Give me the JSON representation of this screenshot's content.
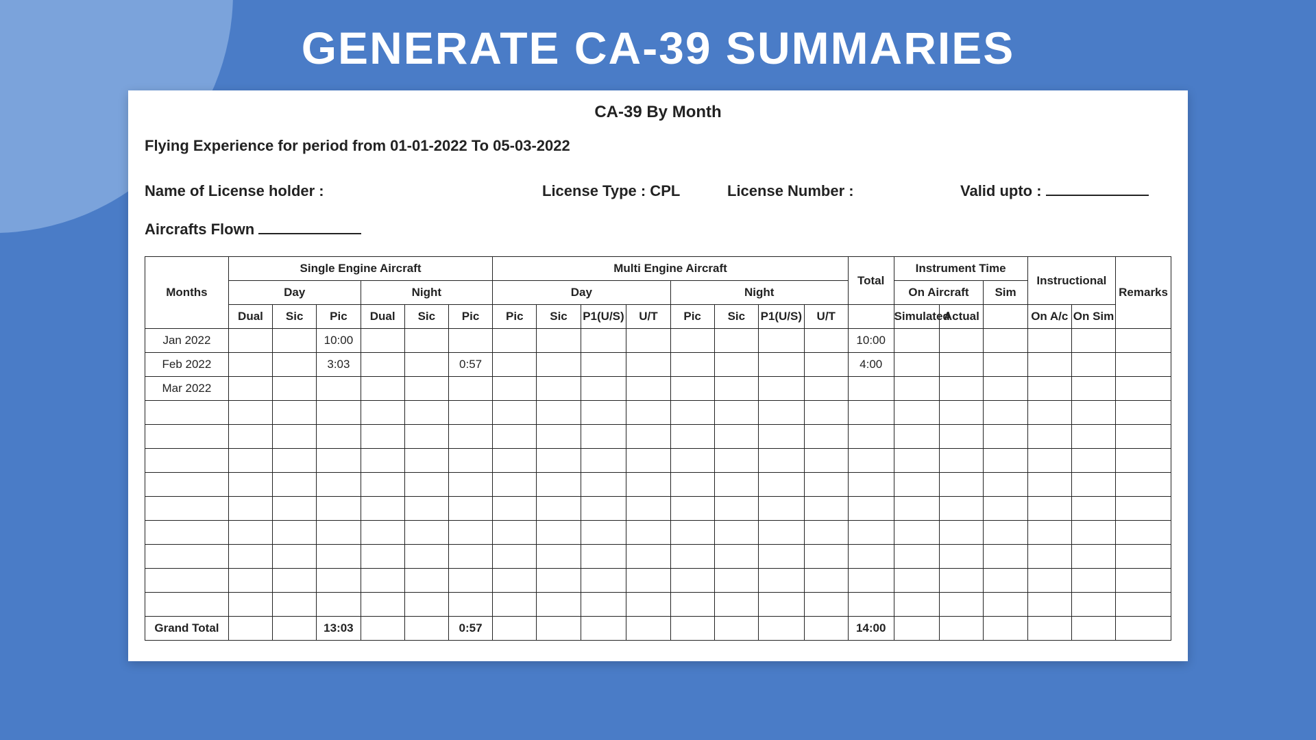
{
  "slide_title": "GENERATE CA-39 SUMMARIES",
  "doc": {
    "title": "CA-39 By Month",
    "period_text": "Flying Experience for period from 01-01-2022 To 05-03-2022",
    "license_holder_label": "Name of License holder :",
    "license_type_label": "License Type : CPL",
    "license_number_label": "License Number :",
    "valid_upto_label": "Valid upto  :",
    "aircrafts_label": "Aircrafts Flown"
  },
  "headers": {
    "months": "Months",
    "single_engine": "Single Engine Aircraft",
    "multi_engine": "Multi Engine Aircraft",
    "total": "Total",
    "instrument_time": "Instrument Time",
    "instructional": "Instructional",
    "remarks": "Remarks",
    "day": "Day",
    "night": "Night",
    "on_aircraft": "On Aircraft",
    "sim": "Sim",
    "dual": "Dual",
    "sic": "Sic",
    "pic": "Pic",
    "p1us": "P1(U/S)",
    "ut": "U/T",
    "simulated": "Simulated",
    "actual": "Actual",
    "on_ac": "On A/c",
    "on_sim": "On Sim"
  },
  "rows": [
    {
      "month": "Jan 2022",
      "cells": [
        "",
        "",
        "10:00",
        "",
        "",
        "",
        "",
        "",
        "",
        "",
        "",
        "",
        "",
        "",
        "10:00",
        "",
        "",
        "",
        "",
        "",
        ""
      ]
    },
    {
      "month": "Feb 2022",
      "cells": [
        "",
        "",
        "3:03",
        "",
        "",
        "0:57",
        "",
        "",
        "",
        "",
        "",
        "",
        "",
        "",
        "4:00",
        "",
        "",
        "",
        "",
        "",
        ""
      ]
    },
    {
      "month": "Mar 2022",
      "cells": [
        "",
        "",
        "",
        "",
        "",
        "",
        "",
        "",
        "",
        "",
        "",
        "",
        "",
        "",
        "",
        "",
        "",
        "",
        "",
        "",
        ""
      ]
    },
    {
      "month": "",
      "cells": [
        "",
        "",
        "",
        "",
        "",
        "",
        "",
        "",
        "",
        "",
        "",
        "",
        "",
        "",
        "",
        "",
        "",
        "",
        "",
        "",
        ""
      ]
    },
    {
      "month": "",
      "cells": [
        "",
        "",
        "",
        "",
        "",
        "",
        "",
        "",
        "",
        "",
        "",
        "",
        "",
        "",
        "",
        "",
        "",
        "",
        "",
        "",
        ""
      ]
    },
    {
      "month": "",
      "cells": [
        "",
        "",
        "",
        "",
        "",
        "",
        "",
        "",
        "",
        "",
        "",
        "",
        "",
        "",
        "",
        "",
        "",
        "",
        "",
        "",
        ""
      ]
    },
    {
      "month": "",
      "cells": [
        "",
        "",
        "",
        "",
        "",
        "",
        "",
        "",
        "",
        "",
        "",
        "",
        "",
        "",
        "",
        "",
        "",
        "",
        "",
        "",
        ""
      ]
    },
    {
      "month": "",
      "cells": [
        "",
        "",
        "",
        "",
        "",
        "",
        "",
        "",
        "",
        "",
        "",
        "",
        "",
        "",
        "",
        "",
        "",
        "",
        "",
        "",
        ""
      ]
    },
    {
      "month": "",
      "cells": [
        "",
        "",
        "",
        "",
        "",
        "",
        "",
        "",
        "",
        "",
        "",
        "",
        "",
        "",
        "",
        "",
        "",
        "",
        "",
        "",
        ""
      ]
    },
    {
      "month": "",
      "cells": [
        "",
        "",
        "",
        "",
        "",
        "",
        "",
        "",
        "",
        "",
        "",
        "",
        "",
        "",
        "",
        "",
        "",
        "",
        "",
        "",
        ""
      ]
    },
    {
      "month": "",
      "cells": [
        "",
        "",
        "",
        "",
        "",
        "",
        "",
        "",
        "",
        "",
        "",
        "",
        "",
        "",
        "",
        "",
        "",
        "",
        "",
        "",
        ""
      ]
    },
    {
      "month": "",
      "cells": [
        "",
        "",
        "",
        "",
        "",
        "",
        "",
        "",
        "",
        "",
        "",
        "",
        "",
        "",
        "",
        "",
        "",
        "",
        "",
        "",
        ""
      ]
    }
  ],
  "grand_total": {
    "label": "Grand Total",
    "cells": [
      "",
      "",
      "13:03",
      "",
      "",
      "0:57",
      "",
      "",
      "",
      "",
      "",
      "",
      "",
      "",
      "14:00",
      "",
      "",
      "",
      "",
      "",
      ""
    ]
  }
}
